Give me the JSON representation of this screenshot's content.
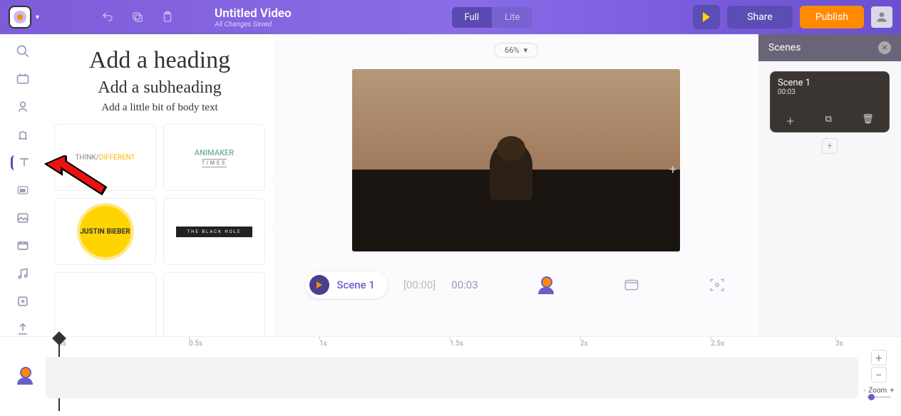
{
  "header": {
    "title": "Untitled Video",
    "save_status": "All Changes Saved",
    "mode_full": "Full",
    "mode_lite": "Lite",
    "share": "Share",
    "publish": "Publish"
  },
  "canvas": {
    "zoom": "66%",
    "scene_label": "Scene 1",
    "time_current": "[00:00]",
    "time_total": "00:03"
  },
  "scenes_panel": {
    "title": "Scenes",
    "card_name": "Scene 1",
    "card_duration": "00:03"
  },
  "text_panel": {
    "heading": "Add a heading",
    "subheading": "Add a subheading",
    "body": "Add a little bit of body text",
    "tpl1_a": "THINK/",
    "tpl1_b": "DIFFERENT",
    "tpl2_a": "ANIMAKER",
    "tpl2_b": "TIMES",
    "tpl3": "JUSTIN BIEBER",
    "tpl4": "THE BLACK HOLE"
  },
  "timeline": {
    "ticks": [
      "0s",
      "0.5s",
      "1s",
      "1.5s",
      "2s",
      "2.5s",
      "3s"
    ],
    "zoom_label": "Zoom"
  }
}
